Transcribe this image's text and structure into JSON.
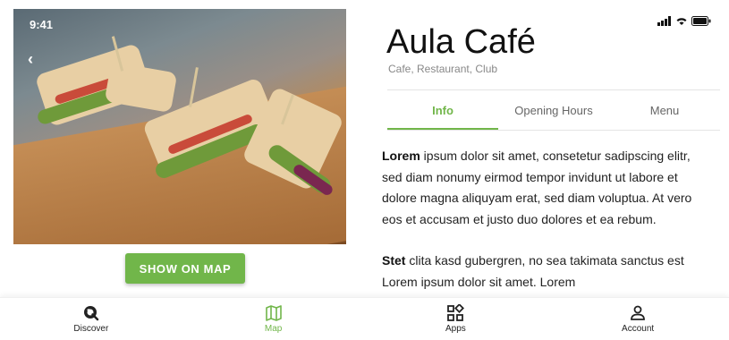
{
  "status_bar": {
    "time": "9:41"
  },
  "hero": {
    "image_alt": "Sandwiches on wooden board",
    "back_icon": "chevron-left-icon"
  },
  "map_button": {
    "label": "SHOW ON MAP"
  },
  "venue": {
    "title": "Aula Café",
    "categories": "Cafe, Restaurant, Club"
  },
  "tabs": [
    {
      "label": "Info",
      "active": true
    },
    {
      "label": "Opening Hours",
      "active": false
    },
    {
      "label": "Menu",
      "active": false
    }
  ],
  "content": {
    "p1_bold": "Lorem",
    "p1_rest": " ipsum dolor sit amet, consetetur sadipscing elitr, sed diam nonumy eirmod tempor invidunt ut labore et dolore magna aliquyam erat, sed diam voluptua. At vero eos et accusam et justo duo dolores et ea rebum.",
    "p2_bold": "Stet",
    "p2_rest": " clita kasd gubergren, no sea takimata sanctus est Lorem ipsum dolor sit amet. Lorem"
  },
  "bottom_nav": [
    {
      "label": "Discover",
      "icon": "discover-icon",
      "active": false
    },
    {
      "label": "Map",
      "icon": "map-icon",
      "active": true
    },
    {
      "label": "Apps",
      "icon": "apps-icon",
      "active": false
    },
    {
      "label": "Account",
      "icon": "account-icon",
      "active": false
    }
  ],
  "colors": {
    "accent": "#71b64a",
    "text": "#222222",
    "muted": "#888888"
  }
}
